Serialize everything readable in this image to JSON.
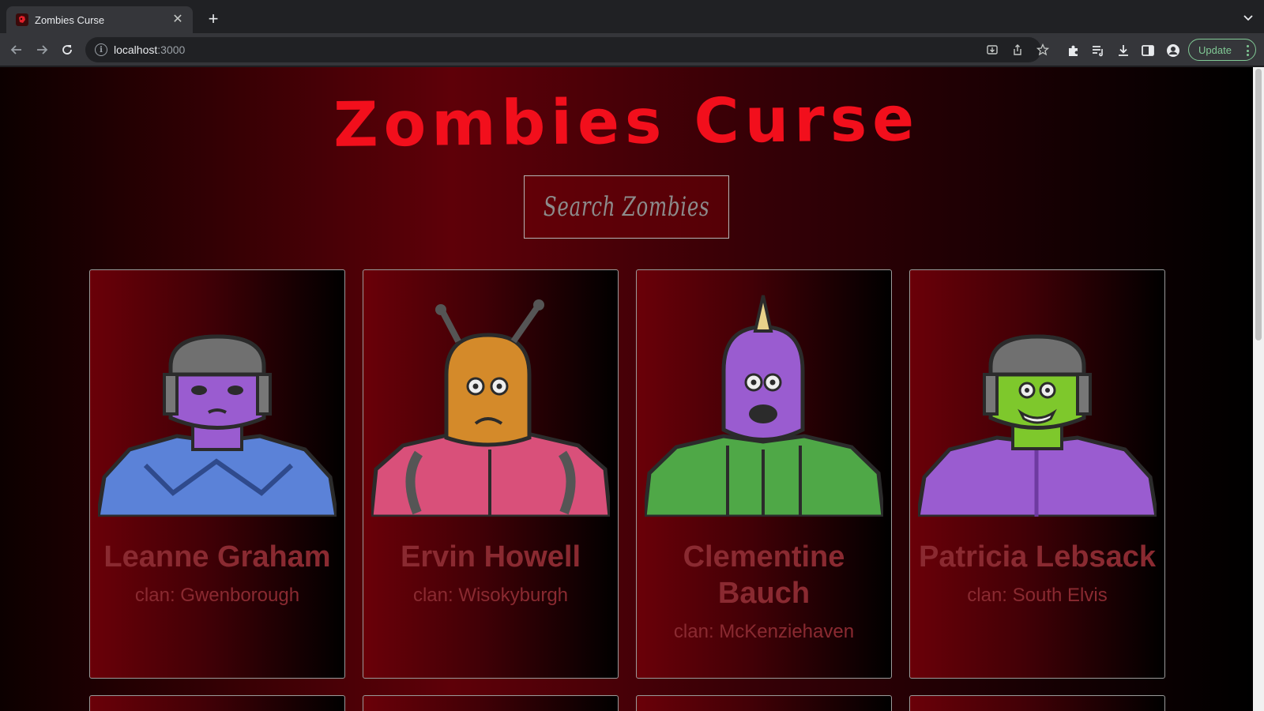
{
  "browser": {
    "tab_title": "Zombies Curse",
    "url_host": "localhost",
    "url_port": ":3000",
    "update_label": "Update"
  },
  "page": {
    "logo_text": "Zombies Curse",
    "search_label": "Search Zombies"
  },
  "zombies": [
    {
      "name": "Leanne Graham",
      "clan": "clan: Gwenborough",
      "face_color": "#9a5cd0",
      "body_color": "#5b82d8"
    },
    {
      "name": "Ervin Howell",
      "clan": "clan: Wisokyburgh",
      "face_color": "#d48a2a",
      "body_color": "#d9507a"
    },
    {
      "name": "Clementine Bauch",
      "clan": "clan: McKenziehaven",
      "face_color": "#9a5cd0",
      "body_color": "#4fa847"
    },
    {
      "name": "Patricia Lebsack",
      "clan": "clan: South Elvis",
      "face_color": "#7ec82c",
      "body_color": "#9a5cd0"
    }
  ],
  "colors": {
    "logo_red": "#f20f1c",
    "card_text": "#8a2a31"
  }
}
